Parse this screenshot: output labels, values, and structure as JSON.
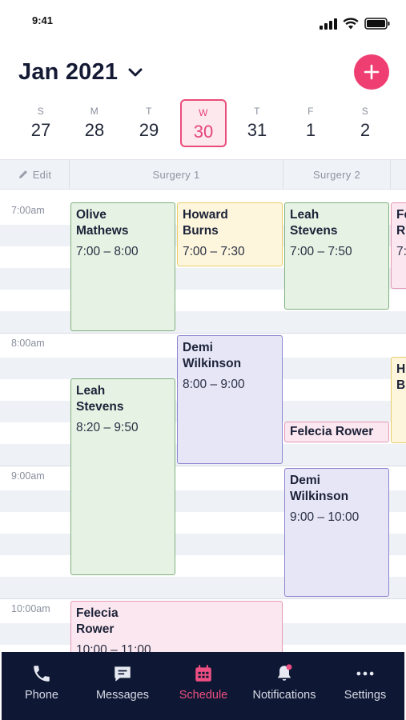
{
  "status_bar": {
    "time": "9:41"
  },
  "header": {
    "month": "Jan 2021"
  },
  "week": [
    {
      "dow": "S",
      "num": "27"
    },
    {
      "dow": "M",
      "num": "28"
    },
    {
      "dow": "T",
      "num": "29"
    },
    {
      "dow": "W",
      "num": "30",
      "selected": true
    },
    {
      "dow": "T",
      "num": "31"
    },
    {
      "dow": "F",
      "num": "1"
    },
    {
      "dow": "S",
      "num": "2"
    }
  ],
  "columns": {
    "edit": "Edit",
    "surgery1": "Surgery 1",
    "surgery2": "Surgery 2"
  },
  "times": [
    "7:00am",
    "8:00am",
    "9:00am",
    "10:00am"
  ],
  "appointments": [
    {
      "name1": "Olive",
      "name2": "Mathews",
      "time": "7:00 – 8:00",
      "color": "green"
    },
    {
      "name1": "Howard",
      "name2": "Burns",
      "time": "7:00 – 7:30",
      "color": "yellow"
    },
    {
      "name1": "Leah",
      "name2": "Stevens",
      "time": "7:00 – 7:50",
      "color": "green"
    },
    {
      "name1": "Fe",
      "name2": "R",
      "time": "7:",
      "color": "pink"
    },
    {
      "name1": "Demi",
      "name2": "Wilkinson",
      "time": "8:00 – 9:00",
      "color": "purple"
    },
    {
      "name1": "Leah",
      "name2": "Stevens",
      "time": "8:20 – 9:50",
      "color": "green"
    },
    {
      "name1": "H",
      "name2": "B",
      "time": "",
      "color": "yellow"
    },
    {
      "name1": "Felecia Rower",
      "name2": "",
      "time": "",
      "color": "pink"
    },
    {
      "name1": "Demi",
      "name2": "Wilkinson",
      "time": "9:00 – 10:00",
      "color": "purple"
    },
    {
      "name1": "Felecia",
      "name2": "Rower",
      "time": "10:00 – 11:00",
      "color": "pink"
    }
  ],
  "tabs": {
    "phone": "Phone",
    "messages": "Messages",
    "schedule": "Schedule",
    "notifications": "Notifications",
    "settings": "Settings",
    "active": "schedule",
    "active_color": "#ee4f82"
  },
  "colors": {
    "accent": "#ef3f72",
    "tabbar": "#0e1733"
  }
}
